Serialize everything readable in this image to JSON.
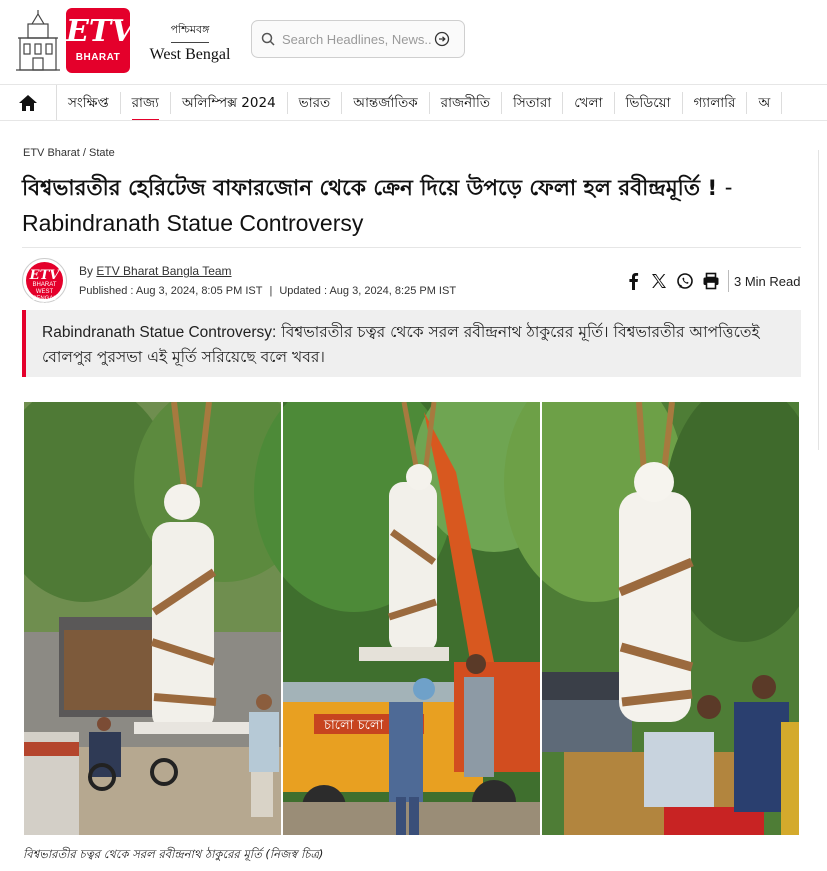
{
  "header": {
    "logo_text": "ETV",
    "logo_sub": "BHARAT",
    "edition_bn": "পশ্চিমবঙ্গ",
    "edition_en": "West Bengal",
    "search_placeholder": "Search Headlines, News..."
  },
  "nav": {
    "items": [
      {
        "label": "সংক্ষিপ্ত"
      },
      {
        "label": "রাজ্য"
      },
      {
        "label": "অলিম্পিক্স 2024"
      },
      {
        "label": "ভারত"
      },
      {
        "label": "আন্তর্জাতিক"
      },
      {
        "label": "রাজনীতি"
      },
      {
        "label": "সিতারা"
      },
      {
        "label": "খেলা"
      },
      {
        "label": "ভিডিয়ো"
      },
      {
        "label": "গ্যালারি"
      },
      {
        "label": "অ"
      }
    ],
    "active_index": 1
  },
  "article": {
    "breadcrumb": "ETV Bharat / State",
    "headline_bn": "বিশ্বভারতীর হেরিটেজ বাফারজোন থেকে ক্রেন দিয়ে উপড়ে ফেলা হল রবীন্দ্রমূর্তি !",
    "headline_en": "- Rabindranath Statue Controversy",
    "author_prefix": "By",
    "author": "ETV Bharat Bangla Team",
    "published": "Published : Aug 3, 2024, 8:05 PM IST",
    "separator": "|",
    "updated": "Updated : Aug 3, 2024, 8:25 PM IST",
    "read_time": "3 Min Read",
    "summary_en": "Rabindranath Statue Controversy:",
    "summary_bn": "বিশ্বভারতীর চত্বর থেকে সরল রবীন্দ্রনাথ ঠাকুরের মূর্তি। বিশ্বভারতীর আপত্তিতেই বোলপুর পুরসভা এই মূর্তি সরিয়েছে বলে খবর।",
    "photo_caption": "বিশ্বভারতীর চত্বর থেকে সরল রবীন্দ্রনাথ ঠাকুরের মূর্তি (নিজস্ব চিত্র)",
    "truck_text": "চালো চলো"
  },
  "avatar": {
    "line1": "ETV",
    "line2": "BHARAT",
    "line3": "WEST BENGAL",
    "line4": "DESK"
  },
  "colors": {
    "brand": "#e4002b",
    "summary_bg": "#efefef"
  }
}
